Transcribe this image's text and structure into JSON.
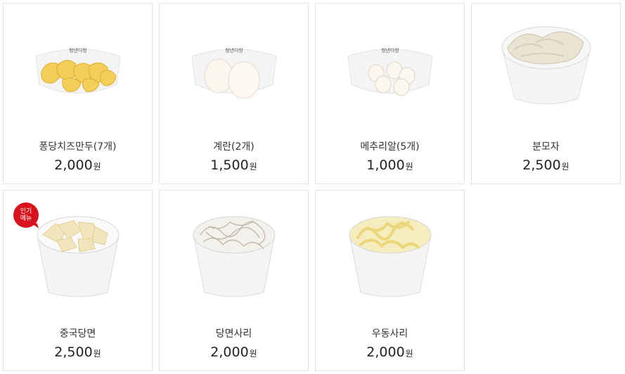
{
  "items": [
    {
      "name": "퐁당치즈만두(7개)",
      "price": "2,000",
      "currency": "원",
      "image": "cheese-dumplings-on-plate",
      "plate_logo": "청년다방"
    },
    {
      "name": "계란(2개)",
      "price": "1,500",
      "currency": "원",
      "image": "boiled-eggs-on-plate",
      "plate_logo": "청년다방"
    },
    {
      "name": "메추리알(5개)",
      "price": "1,000",
      "currency": "원",
      "image": "quail-eggs-on-plate",
      "plate_logo": "청년다방"
    },
    {
      "name": "분모자",
      "price": "2,500",
      "currency": "원",
      "image": "bunmoja-in-bowl"
    },
    {
      "name": "중국당면",
      "price": "2,500",
      "currency": "원",
      "image": "chinese-glass-noodles-cup",
      "badge": {
        "line1": "인기",
        "line2": "메뉴"
      }
    },
    {
      "name": "당면사리",
      "price": "2,000",
      "currency": "원",
      "image": "glass-noodles-cup"
    },
    {
      "name": "우동사리",
      "price": "2,000",
      "currency": "원",
      "image": "udon-noodles-cup"
    }
  ],
  "colors": {
    "badge": "#d8131d",
    "border": "#e3e3e3",
    "text": "#222222"
  }
}
